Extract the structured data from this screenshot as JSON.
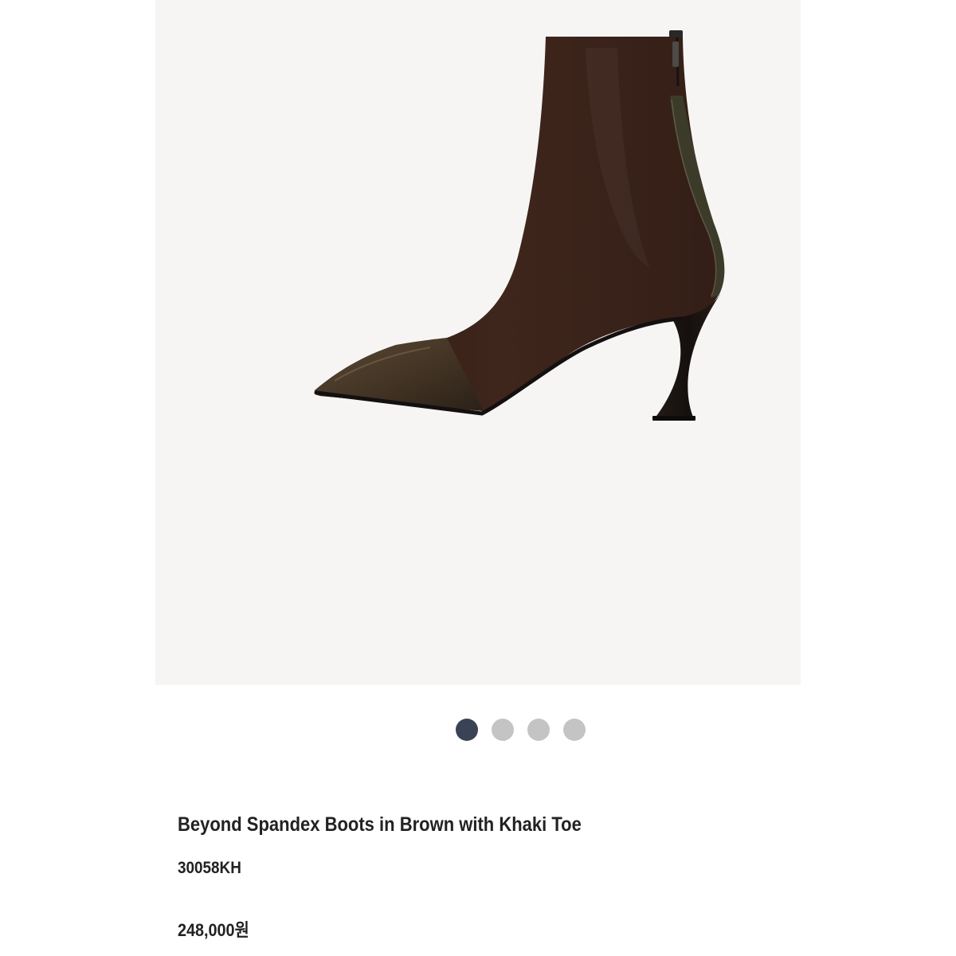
{
  "product": {
    "title": "Beyond Spandex Boots in Brown with Khaki Toe",
    "sku": "30058KH",
    "price": "248,000원"
  },
  "carousel": {
    "total": 4,
    "active_index": 0
  },
  "colors": {
    "active_dot": "#3a4256",
    "inactive_dot": "#c4c4c4",
    "image_background": "#f6f5f3",
    "boot_shaft": "#3a2219",
    "toe_cap": "#4a3a28",
    "heel": "#1a1412",
    "text": "#222222"
  }
}
